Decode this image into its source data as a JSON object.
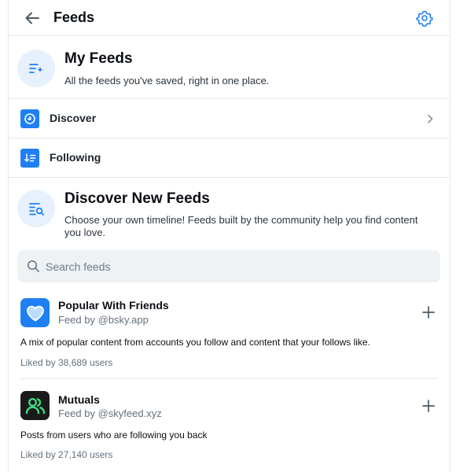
{
  "header": {
    "title": "Feeds",
    "back_icon": "arrow-left-icon",
    "settings_icon": "gear-icon"
  },
  "my_feeds": {
    "title": "My Feeds",
    "description": "All the feeds you've saved, right in one place.",
    "icon": "list-sparkle-icon"
  },
  "saved_feeds": [
    {
      "label": "Discover",
      "icon": "compass-icon",
      "has_chevron": true
    },
    {
      "label": "Following",
      "icon": "sort-list-icon",
      "has_chevron": false
    }
  ],
  "discover_new": {
    "title": "Discover New Feeds",
    "description": "Choose your own timeline! Feeds built by the community help you find content you love.",
    "icon": "list-search-icon"
  },
  "search": {
    "placeholder": "Search feeds",
    "value": ""
  },
  "feeds": [
    {
      "name": "Popular With Friends",
      "by": "Feed by @bsky.app",
      "description": "A mix of popular content from accounts you follow and content that your follows like.",
      "likes": "Liked by 38,689 users",
      "avatar_icon": "heart-icon",
      "avatar_color": "#1f7ff5"
    },
    {
      "name": "Mutuals",
      "by": "Feed by @skyfeed.xyz",
      "description": "Posts from users who are following you back",
      "likes": "Liked by 27,140 users",
      "avatar_icon": "people-icon",
      "avatar_color": "#1a1a1a"
    }
  ],
  "colors": {
    "accent": "#1f7ff5",
    "icon_bg": "#e7f1fd",
    "border": "#e4e8ec",
    "muted": "#65717d"
  }
}
